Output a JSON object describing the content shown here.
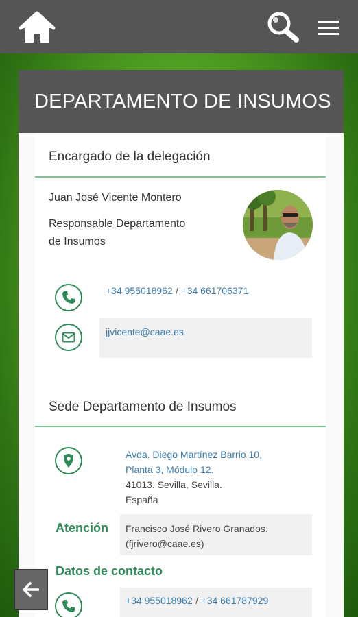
{
  "header": {
    "home_icon": "home-icon",
    "search_icon": "search-icon",
    "menu_icon": "menu-icon"
  },
  "card": {
    "title": "DEPARTAMENTO DE INSUMOS",
    "delegate_section": {
      "title": "Encargado de la delegación",
      "name": "Juan José Vicente Montero",
      "role_line1": "Responsable Departamento",
      "role_line2": "de Insumos",
      "phone1": "+34 955018962",
      "phone_separator": "/",
      "phone2": "+34 661706371",
      "email": "jjvicente@caae.es"
    },
    "headquarters_section": {
      "title": "Sede Departamento de Insumos",
      "address_line1": "Avda. Diego Martínez Barrio 10,",
      "address_line2": "Planta 3, Módulo 12.",
      "address_line3": "41013. Sevilla, Sevilla.",
      "address_line4": "España",
      "attention_label": "Atención",
      "attention_line1": "Francisco José Rivero Granados.",
      "attention_line2": "(fjrivero@caae.es)",
      "contact_label": "Datos de contacto",
      "phone1": "+34 955018962",
      "phone_separator": "/",
      "phone2": "+34 661787929"
    }
  },
  "footer": {
    "back_icon": "arrow-left-icon"
  },
  "colors": {
    "bar": "#555555",
    "accent_green": "#2e8a57",
    "divider_green": "#7cc48f",
    "link_blue": "#3d7eae"
  }
}
